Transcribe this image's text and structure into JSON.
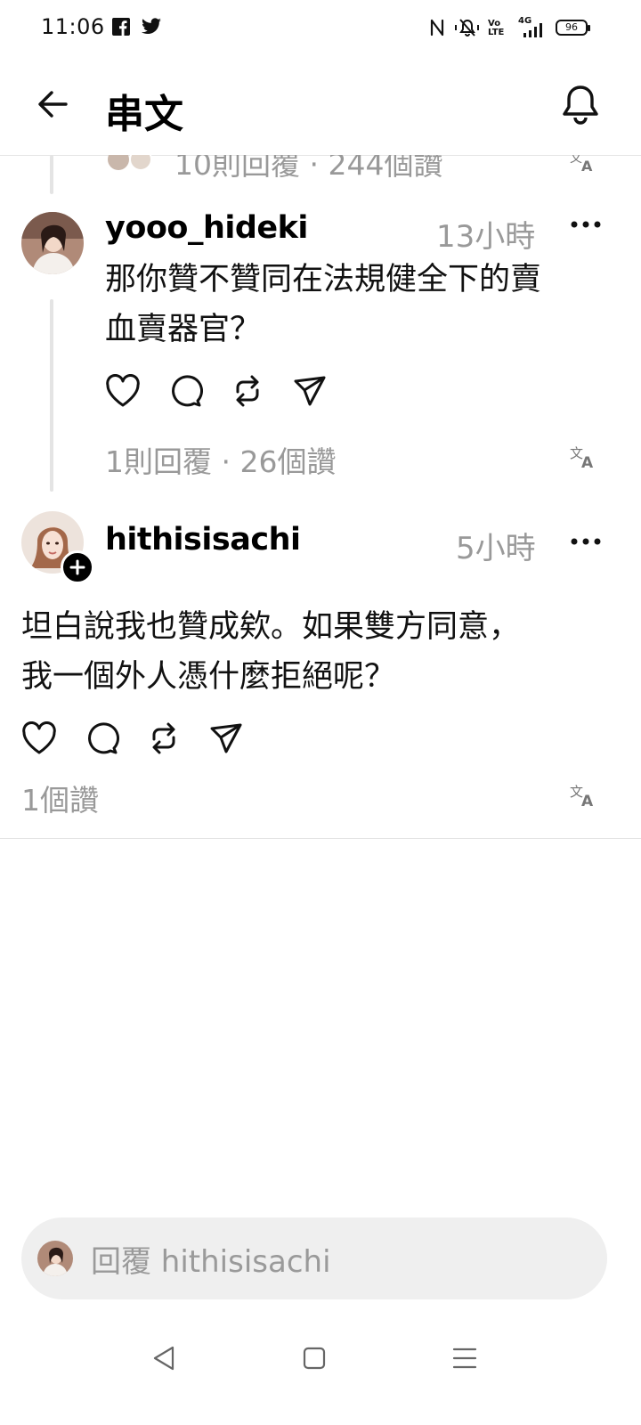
{
  "status_bar": {
    "time": "11:06",
    "battery": "96",
    "network": "4G",
    "volte": "Vo LTE",
    "icons": [
      "facebook-icon",
      "twitter-icon",
      "nfc-icon",
      "mute-icon",
      "volte-icon",
      "signal-icon",
      "battery-icon"
    ]
  },
  "header": {
    "title": "串文"
  },
  "prev_post": {
    "meta": "10則回覆 · 244個讚"
  },
  "posts": [
    {
      "username": "yooo_hideki",
      "time": "13小時",
      "text_line1": "那你贊不贊同在法規健全下的賣",
      "text_line2": "血賣器官？",
      "meta": "1則回覆 · 26個讚"
    },
    {
      "username": "hithisisachi",
      "time": "5小時",
      "text_line1": "坦白說我也贊成欸。如果雙方同意，",
      "text_line2": "我一個外人憑什麼拒絕呢？",
      "meta": "1個讚"
    }
  ],
  "reply": {
    "placeholder": "回覆 hithisisachi"
  },
  "colors": {
    "muted": "#999999",
    "divider": "#e3e3e3",
    "reply_bg": "#efefef"
  }
}
